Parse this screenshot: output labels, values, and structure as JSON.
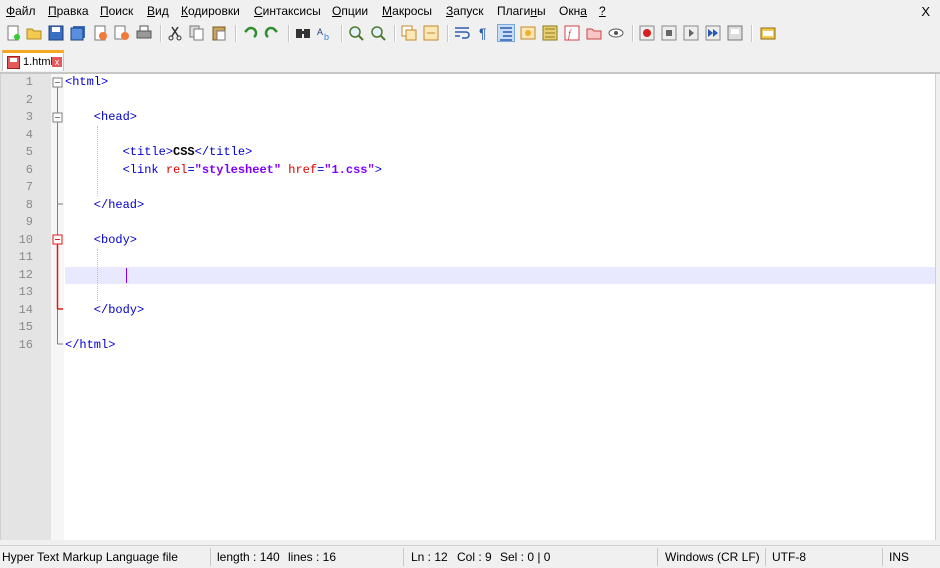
{
  "menu": {
    "items": [
      {
        "u": "Ф",
        "rest": "айл"
      },
      {
        "u": "П",
        "rest": "равка"
      },
      {
        "u": "П",
        "rest": "оиск"
      },
      {
        "u": "В",
        "rest": "ид"
      },
      {
        "u": "К",
        "rest": "одировки"
      },
      {
        "u": "С",
        "rest": "интаксисы"
      },
      {
        "u": "О",
        "rest": "пции"
      },
      {
        "u": "М",
        "rest": "акросы"
      },
      {
        "u": "З",
        "rest": "апуск"
      },
      {
        "u": "",
        "rest": "Плаги",
        "u2": "н",
        "rest2": "ы"
      },
      {
        "u": "",
        "rest": "Окн",
        "u2": "а",
        "rest2": ""
      },
      {
        "u": "?",
        "rest": ""
      }
    ],
    "close": "X"
  },
  "tab": {
    "label": "1.html",
    "close": "x"
  },
  "editor": {
    "line_numbers": [
      "1",
      "2",
      "3",
      "4",
      "5",
      "6",
      "7",
      "8",
      "9",
      "10",
      "11",
      "12",
      "13",
      "14",
      "15",
      "16"
    ],
    "lines": [
      "<html>",
      "",
      "    <head>",
      "",
      "        <title>CSS</title>",
      "        <link rel=\"stylesheet\" href=\"1.css\">",
      "",
      "    </head>",
      "",
      "    <body>",
      "",
      "",
      "",
      "    </body>",
      "",
      "</html>"
    ],
    "current_line": 12
  },
  "status": {
    "file_type": "Hyper Text Markup Language file",
    "length": "length : 140",
    "lines": "lines : 16",
    "ln": "Ln : 12",
    "col": "Col : 9",
    "sel": "Sel : 0 | 0",
    "eol": "Windows (CR LF)",
    "encoding": "UTF-8",
    "mode": "INS"
  },
  "colors": {
    "tag": "#0000cc",
    "attr": "#dd0000",
    "value": "#8000ff",
    "current_line": "#e8e8ff"
  }
}
